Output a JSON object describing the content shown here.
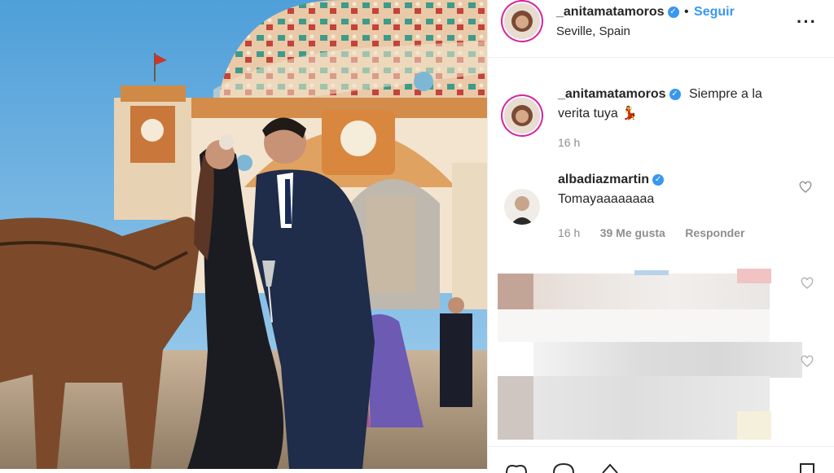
{
  "post": {
    "username": "_anitamatamoros",
    "follow_label": "Seguir",
    "location": "Seville, Spain",
    "more_icon": "more-options-icon"
  },
  "caption": {
    "username": "_anitamatamoros",
    "text_line1": "Siempre a la",
    "text_line2": "verita tuya",
    "emoji": "💃",
    "time": "16 h"
  },
  "comments": [
    {
      "username": "albadiazmartin",
      "text": "Tomayaaaaaaaa",
      "time": "16 h",
      "likes": "39 Me gusta",
      "reply_label": "Responder"
    }
  ],
  "colors": {
    "link": "#3897f0",
    "muted": "#8e8e8e",
    "text": "#262626"
  },
  "icons": [
    "verified-badge-icon",
    "heart-icon",
    "comment-icon",
    "share-icon",
    "bookmark-icon"
  ]
}
